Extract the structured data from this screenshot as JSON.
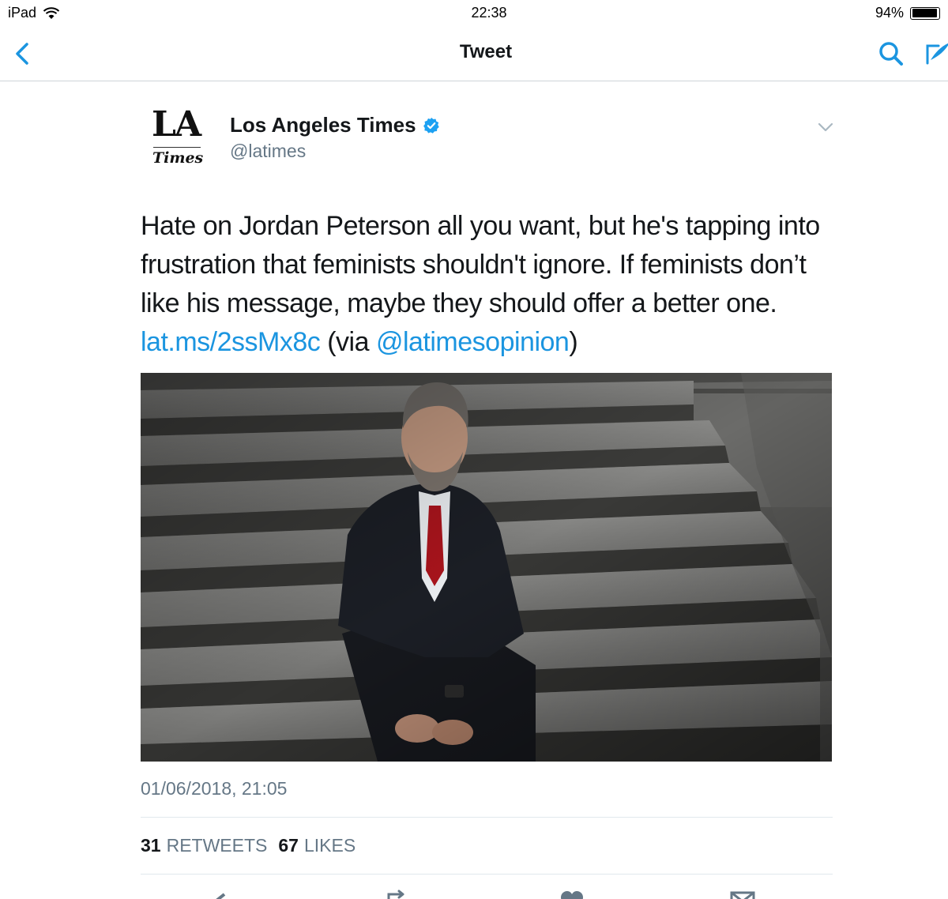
{
  "status_bar": {
    "device": "iPad",
    "time": "22:38",
    "battery": "94%",
    "battery_level": 0.94
  },
  "nav": {
    "title": "Tweet"
  },
  "tweet": {
    "author_name": "Los Angeles Times",
    "author_handle": "@latimes",
    "logo_text_top": "LA",
    "logo_text_bottom": "Times",
    "text_plain_1": "Hate on Jordan Peterson all you want, but he's tapping into frustration that feminists shouldn't ignore. If feminists don’t like his message, maybe they should offer a better one. ",
    "link": "lat.ms/2ssMx8c",
    "text_plain_2": " (via ",
    "mention": "@latimesopinion",
    "text_plain_3": ")",
    "timestamp": "01/06/2018, 21:05",
    "retweets_count": "31",
    "retweets_label": "RETWEETS",
    "likes_count": "67",
    "likes_label": "LIKES"
  },
  "colors": {
    "accent": "#1b95e0",
    "muted": "#657786",
    "verified": "#1da1f2"
  },
  "icons": [
    "back-chevron-icon",
    "search-icon",
    "compose-icon",
    "verified-badge-icon",
    "caret-down-icon",
    "reply-icon",
    "retweet-icon",
    "like-icon",
    "message-icon"
  ]
}
